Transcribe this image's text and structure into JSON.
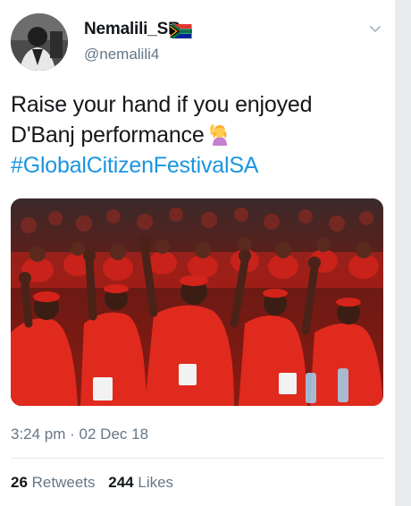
{
  "user": {
    "display_name": "Nemalili_SR",
    "handle": "@nemalili4",
    "flag_icon": "south-africa-flag-icon"
  },
  "tweet": {
    "line1": "Raise your hand if you enjoyed",
    "line2": "D'Banj performance",
    "emoji_icon": "woman-raising-hand-emoji",
    "hashtag": "#GlobalCitizenFestivalSA"
  },
  "meta": {
    "timestamp": "3:24 pm · 02 Dec 18"
  },
  "stats": {
    "retweets_count": "26",
    "retweets_label": "Retweets",
    "likes_count": "244",
    "likes_label": "Likes"
  },
  "colors": {
    "link": "#1b95e0",
    "text": "#14171a",
    "secondary": "#657786"
  }
}
